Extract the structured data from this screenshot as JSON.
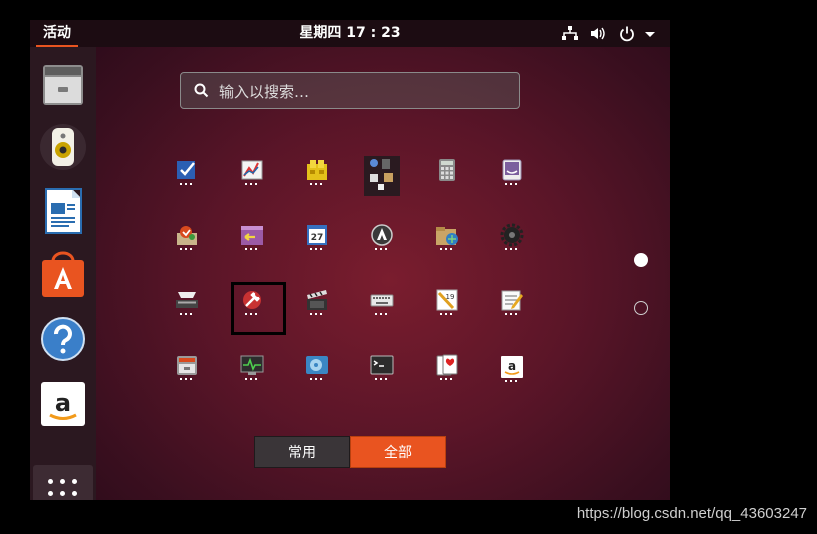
{
  "topbar": {
    "activities": "活动",
    "clock": "星期四 17 : 23",
    "tray_icons": [
      "network-icon",
      "volume-icon",
      "power-icon",
      "chevron-down-icon"
    ]
  },
  "search": {
    "placeholder": "输入以搜索…"
  },
  "dock": {
    "items": [
      "files-icon",
      "rhythmbox-icon",
      "libreoffice-writer-icon",
      "software-center-icon",
      "help-icon",
      "amazon-icon"
    ],
    "apps_button_icon": "show-applications-icon"
  },
  "app_grid": {
    "icons": [
      "todo-check-icon",
      "system-monitor-chart-icon",
      "office-suite-icon",
      "mixed-tools-icon",
      "calculator-icon",
      "dictionary-icon",
      "backup-icon",
      "import-export-icon",
      "calendar-icon",
      "software-updater-icon",
      "file-roller-icon",
      "settings-gear-icon",
      "scanner-icon",
      "preferences-tool-icon",
      "video-editor-icon",
      "keyboard-icon",
      "notes-clock-icon",
      "text-editor-icon",
      "archive-manager-icon",
      "system-monitor-icon",
      "disks-icon",
      "terminal-icon",
      "solitaire-cards-icon",
      "amazon-store-icon"
    ],
    "selected_icon": "preferences-tool-icon",
    "pages": 2,
    "current_page": 1
  },
  "switcher": {
    "frequent": "常用",
    "all": "全部",
    "active": "all"
  },
  "colors": {
    "accent": "#e95420",
    "panel": "#1c0c12",
    "dock": "#2b1820"
  },
  "watermark": "https://blog.csdn.net/qq_43603247"
}
